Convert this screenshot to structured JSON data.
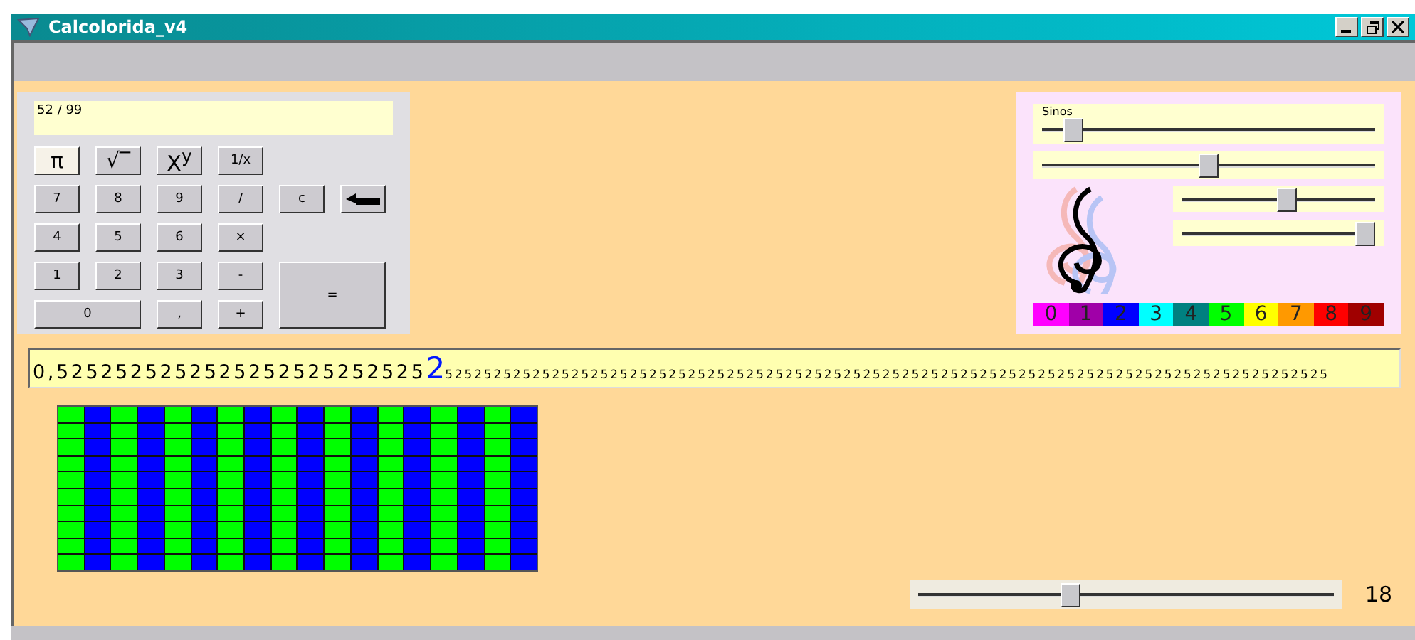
{
  "window": {
    "title": "Calcolorida_v4"
  },
  "calculator": {
    "display": "52 / 99",
    "key_rows": [
      [
        {
          "label": "π",
          "kind": "key",
          "highlight": true
        },
        {
          "label": "√‾",
          "kind": "key",
          "highlight": false
        },
        {
          "label": "X$^{y}$",
          "kind": "key",
          "highlight": false
        },
        {
          "label": "1/x",
          "kind": "key",
          "highlight": false
        }
      ],
      [
        {
          "label": "7",
          "kind": "key",
          "highlight": false
        },
        {
          "label": "8",
          "kind": "key",
          "highlight": false
        },
        {
          "label": "9",
          "kind": "key",
          "highlight": false
        },
        {
          "label": "/",
          "kind": "key",
          "highlight": false
        },
        {
          "label": "c",
          "kind": "key",
          "highlight": false
        },
        {
          "kind": "enter",
          "highlight": false
        }
      ],
      [
        {
          "label": "4",
          "kind": "key",
          "highlight": false
        },
        {
          "label": "5",
          "kind": "key",
          "highlight": false
        },
        {
          "label": "6",
          "kind": "key",
          "highlight": false
        },
        {
          "label": "×",
          "kind": "key",
          "highlight": false
        }
      ],
      [
        {
          "label": "1",
          "kind": "key",
          "highlight": false
        },
        {
          "label": "2",
          "kind": "key",
          "highlight": false
        },
        {
          "label": "3",
          "kind": "key",
          "highlight": false
        },
        {
          "label": "-",
          "kind": "key",
          "highlight": false
        },
        {
          "label": "=",
          "kind": "tall",
          "highlight": false
        }
      ],
      [
        {
          "label": "0",
          "kind": "wide",
          "highlight": false
        },
        {
          "label": ",",
          "kind": "key",
          "highlight": false
        },
        {
          "label": "+",
          "kind": "key",
          "highlight": false
        }
      ]
    ]
  },
  "sound_panel": {
    "label": "Sinos",
    "sliders": [
      {
        "level": 0.07
      },
      {
        "level": 0.5
      }
    ],
    "small_sliders": [
      {
        "level": 0.55
      },
      {
        "level": 1
      }
    ],
    "palette": [
      {
        "label": "0",
        "color": "#ff00ff"
      },
      {
        "label": "1",
        "color": "#a000a8"
      },
      {
        "label": "2",
        "color": "#0000ff"
      },
      {
        "label": "3",
        "color": "#00ffff"
      },
      {
        "label": "4",
        "color": "#008080"
      },
      {
        "label": "5",
        "color": "#00ff00"
      },
      {
        "label": "6",
        "color": "#ffff00"
      },
      {
        "label": "7",
        "color": "#ff9900"
      },
      {
        "label": "8",
        "color": "#ff0000"
      },
      {
        "label": "9",
        "color": "#a00000"
      }
    ]
  },
  "decimal": {
    "before": "0,5252525252525252525252525",
    "current": "2",
    "after": "5252525252525252525252525252525252525252525252525252525252525252525252525252525252525252525"
  },
  "grid": {
    "rows": [
      {
        "cells": [
          {
            "color": "#00ff00"
          },
          {
            "color": "#0000ff"
          },
          {
            "color": "#00ff00"
          },
          {
            "color": "#0000ff"
          },
          {
            "color": "#00ff00"
          },
          {
            "color": "#0000ff"
          },
          {
            "color": "#00ff00"
          },
          {
            "color": "#0000ff"
          },
          {
            "color": "#00ff00"
          },
          {
            "color": "#0000ff"
          },
          {
            "color": "#00ff00"
          },
          {
            "color": "#0000ff"
          },
          {
            "color": "#00ff00"
          },
          {
            "color": "#0000ff"
          },
          {
            "color": "#00ff00"
          },
          {
            "color": "#0000ff"
          },
          {
            "color": "#00ff00"
          },
          {
            "color": "#0000ff"
          }
        ]
      },
      {
        "cells": [
          {
            "color": "#00ff00"
          },
          {
            "color": "#0000ff"
          },
          {
            "color": "#00ff00"
          },
          {
            "color": "#0000ff"
          },
          {
            "color": "#00ff00"
          },
          {
            "color": "#0000ff"
          },
          {
            "color": "#00ff00"
          },
          {
            "color": "#0000ff"
          },
          {
            "color": "#00ff00"
          },
          {
            "color": "#0000ff"
          },
          {
            "color": "#00ff00"
          },
          {
            "color": "#0000ff"
          },
          {
            "color": "#00ff00"
          },
          {
            "color": "#0000ff"
          },
          {
            "color": "#00ff00"
          },
          {
            "color": "#0000ff"
          },
          {
            "color": "#00ff00"
          },
          {
            "color": "#0000ff"
          }
        ]
      },
      {
        "cells": [
          {
            "color": "#00ff00"
          },
          {
            "color": "#0000ff"
          },
          {
            "color": "#00ff00"
          },
          {
            "color": "#0000ff"
          },
          {
            "color": "#00ff00"
          },
          {
            "color": "#0000ff"
          },
          {
            "color": "#00ff00"
          },
          {
            "color": "#0000ff"
          },
          {
            "color": "#00ff00"
          },
          {
            "color": "#0000ff"
          },
          {
            "color": "#00ff00"
          },
          {
            "color": "#0000ff"
          },
          {
            "color": "#00ff00"
          },
          {
            "color": "#0000ff"
          },
          {
            "color": "#00ff00"
          },
          {
            "color": "#0000ff"
          },
          {
            "color": "#00ff00"
          },
          {
            "color": "#0000ff"
          }
        ]
      },
      {
        "cells": [
          {
            "color": "#00ff00"
          },
          {
            "color": "#0000ff"
          },
          {
            "color": "#00ff00"
          },
          {
            "color": "#0000ff"
          },
          {
            "color": "#00ff00"
          },
          {
            "color": "#0000ff"
          },
          {
            "color": "#00ff00"
          },
          {
            "color": "#0000ff"
          },
          {
            "color": "#00ff00"
          },
          {
            "color": "#0000ff"
          },
          {
            "color": "#00ff00"
          },
          {
            "color": "#0000ff"
          },
          {
            "color": "#00ff00"
          },
          {
            "color": "#0000ff"
          },
          {
            "color": "#00ff00"
          },
          {
            "color": "#0000ff"
          },
          {
            "color": "#00ff00"
          },
          {
            "color": "#0000ff"
          }
        ]
      },
      {
        "cells": [
          {
            "color": "#00ff00"
          },
          {
            "color": "#0000ff"
          },
          {
            "color": "#00ff00"
          },
          {
            "color": "#0000ff"
          },
          {
            "color": "#00ff00"
          },
          {
            "color": "#0000ff"
          },
          {
            "color": "#00ff00"
          },
          {
            "color": "#0000ff"
          },
          {
            "color": "#00ff00"
          },
          {
            "color": "#0000ff"
          },
          {
            "color": "#00ff00"
          },
          {
            "color": "#0000ff"
          },
          {
            "color": "#00ff00"
          },
          {
            "color": "#0000ff"
          },
          {
            "color": "#00ff00"
          },
          {
            "color": "#0000ff"
          },
          {
            "color": "#00ff00"
          },
          {
            "color": "#0000ff"
          }
        ]
      },
      {
        "cells": [
          {
            "color": "#00ff00"
          },
          {
            "color": "#0000ff"
          },
          {
            "color": "#00ff00"
          },
          {
            "color": "#0000ff"
          },
          {
            "color": "#00ff00"
          },
          {
            "color": "#0000ff"
          },
          {
            "color": "#00ff00"
          },
          {
            "color": "#0000ff"
          },
          {
            "color": "#00ff00"
          },
          {
            "color": "#0000ff"
          },
          {
            "color": "#00ff00"
          },
          {
            "color": "#0000ff"
          },
          {
            "color": "#00ff00"
          },
          {
            "color": "#0000ff"
          },
          {
            "color": "#00ff00"
          },
          {
            "color": "#0000ff"
          },
          {
            "color": "#00ff00"
          },
          {
            "color": "#0000ff"
          }
        ]
      },
      {
        "cells": [
          {
            "color": "#00ff00"
          },
          {
            "color": "#0000ff"
          },
          {
            "color": "#00ff00"
          },
          {
            "color": "#0000ff"
          },
          {
            "color": "#00ff00"
          },
          {
            "color": "#0000ff"
          },
          {
            "color": "#00ff00"
          },
          {
            "color": "#0000ff"
          },
          {
            "color": "#00ff00"
          },
          {
            "color": "#0000ff"
          },
          {
            "color": "#00ff00"
          },
          {
            "color": "#0000ff"
          },
          {
            "color": "#00ff00"
          },
          {
            "color": "#0000ff"
          },
          {
            "color": "#00ff00"
          },
          {
            "color": "#0000ff"
          },
          {
            "color": "#00ff00"
          },
          {
            "color": "#0000ff"
          }
        ]
      },
      {
        "cells": [
          {
            "color": "#00ff00"
          },
          {
            "color": "#0000ff"
          },
          {
            "color": "#00ff00"
          },
          {
            "color": "#0000ff"
          },
          {
            "color": "#00ff00"
          },
          {
            "color": "#0000ff"
          },
          {
            "color": "#00ff00"
          },
          {
            "color": "#0000ff"
          },
          {
            "color": "#00ff00"
          },
          {
            "color": "#0000ff"
          },
          {
            "color": "#00ff00"
          },
          {
            "color": "#0000ff"
          },
          {
            "color": "#00ff00"
          },
          {
            "color": "#0000ff"
          },
          {
            "color": "#00ff00"
          },
          {
            "color": "#0000ff"
          },
          {
            "color": "#00ff00"
          },
          {
            "color": "#0000ff"
          }
        ]
      },
      {
        "cells": [
          {
            "color": "#00ff00"
          },
          {
            "color": "#0000ff"
          },
          {
            "color": "#00ff00"
          },
          {
            "color": "#0000ff"
          },
          {
            "color": "#00ff00"
          },
          {
            "color": "#0000ff"
          },
          {
            "color": "#00ff00"
          },
          {
            "color": "#0000ff"
          },
          {
            "color": "#00ff00"
          },
          {
            "color": "#0000ff"
          },
          {
            "color": "#00ff00"
          },
          {
            "color": "#0000ff"
          },
          {
            "color": "#00ff00"
          },
          {
            "color": "#0000ff"
          },
          {
            "color": "#00ff00"
          },
          {
            "color": "#0000ff"
          },
          {
            "color": "#00ff00"
          },
          {
            "color": "#0000ff"
          }
        ]
      },
      {
        "cells": [
          {
            "color": "#00ff00"
          },
          {
            "color": "#0000ff"
          },
          {
            "color": "#00ff00"
          },
          {
            "color": "#0000ff"
          },
          {
            "color": "#00ff00"
          },
          {
            "color": "#0000ff"
          },
          {
            "color": "#00ff00"
          },
          {
            "color": "#0000ff"
          },
          {
            "color": "#00ff00"
          },
          {
            "color": "#0000ff"
          },
          {
            "color": "#00ff00"
          },
          {
            "color": "#0000ff"
          },
          {
            "color": "#00ff00"
          },
          {
            "color": "#0000ff"
          },
          {
            "color": "#00ff00"
          },
          {
            "color": "#0000ff"
          },
          {
            "color": "#00ff00"
          },
          {
            "color": "#0000ff"
          }
        ]
      }
    ]
  },
  "speed": {
    "level": 0.36,
    "reading": "18"
  }
}
